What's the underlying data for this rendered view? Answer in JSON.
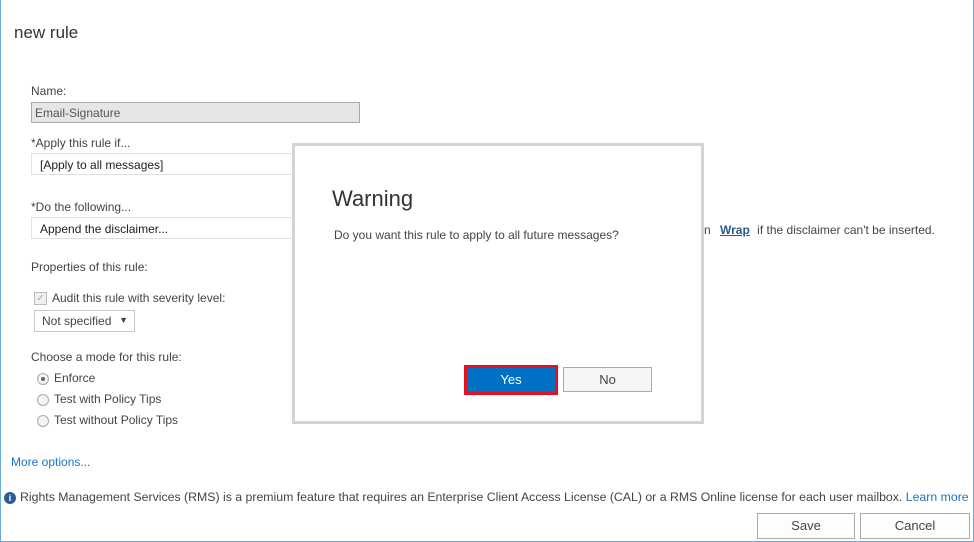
{
  "page": {
    "title": "new rule"
  },
  "form": {
    "name_label": "Name:",
    "name_value": "Email-Signature",
    "apply_label": "*Apply this rule if...",
    "apply_value": "[Apply to all messages]",
    "do_label": "*Do the following...",
    "do_value": "Append the disclaimer...",
    "do_suffix_partial": "n",
    "wrap_link": "Wrap",
    "do_suffix": "if the disclaimer can't be inserted.",
    "properties_label": "Properties of this rule:",
    "audit_label": "Audit this rule with severity level:",
    "audit_checked": true,
    "severity_value": "Not specified",
    "mode_label": "Choose a mode for this rule:",
    "modes": [
      {
        "label": "Enforce",
        "selected": true
      },
      {
        "label": "Test with Policy Tips",
        "selected": false
      },
      {
        "label": "Test without Policy Tips",
        "selected": false
      }
    ],
    "more_options": "More options...",
    "rms_notice": "Rights Management Services (RMS) is a premium feature that requires an Enterprise Client Access License (CAL) or a RMS Online license for each user mailbox.",
    "learn_more": "Learn more",
    "save": "Save",
    "cancel": "Cancel"
  },
  "dialog": {
    "title": "Warning",
    "message": "Do you want this rule to apply to all future messages?",
    "yes": "Yes",
    "no": "No"
  },
  "colors": {
    "accent": "#0072c6",
    "highlight": "#e81123",
    "link": "#1a73c6"
  }
}
